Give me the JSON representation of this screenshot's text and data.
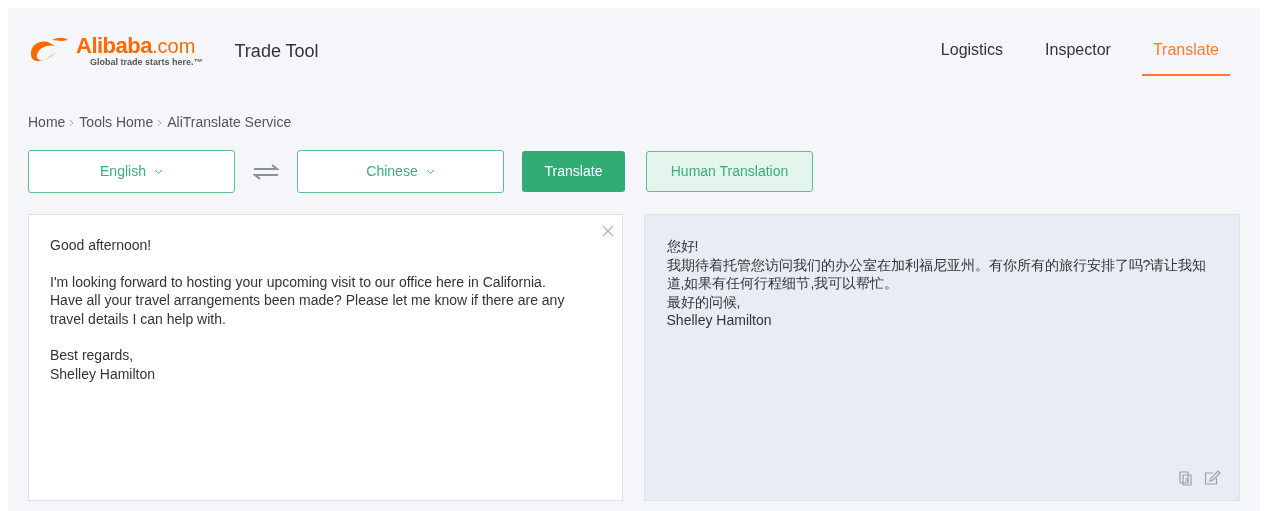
{
  "logo": {
    "brand": "Alibaba",
    "domain": ".com",
    "tagline": "Global trade starts here.™"
  },
  "app_title": "Trade Tool",
  "nav": [
    {
      "label": "Logistics",
      "selected": false
    },
    {
      "label": "Inspector",
      "selected": false
    },
    {
      "label": "Translate",
      "selected": true
    }
  ],
  "breadcrumb": [
    "Home",
    "Tools Home",
    "AliTranslate Service"
  ],
  "source_language": "English",
  "target_language": "Chinese",
  "buttons": {
    "translate": "Translate",
    "human_translation": "Human Translation"
  },
  "source_text": [
    "Good afternoon!",
    "I'm looking forward to hosting your upcoming visit to our office here in California. Have all your travel arrangements been made? Please let me know if there are any travel details I can help with.",
    "Best regards,\nShelley Hamilton"
  ],
  "result_text": [
    "您好!",
    "我期待着托管您访问我们的办公室在加利福尼亚州。有你所有的旅行安排了吗?请让我知道,如果有任何行程细节,我可以帮忙。",
    "最好的问候,",
    "Shelley Hamilton"
  ]
}
